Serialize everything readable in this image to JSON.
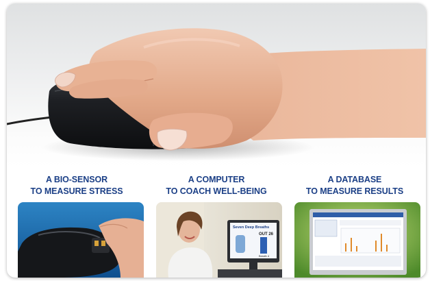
{
  "panels": [
    {
      "line1": "A BIO-SENSOR",
      "line2": "TO MEASURE STRESS"
    },
    {
      "line1": "A COMPUTER",
      "line2": "TO COACH WELL-BEING"
    },
    {
      "line1": "A DATABASE",
      "line2": "TO MEASURE RESULTS"
    }
  ],
  "screen": {
    "heading": "Seven Deep Breaths",
    "counter": "OUT 26",
    "footer": "Breath 4"
  },
  "colors": {
    "label_blue": "#1b3f86",
    "mouse_black": "#1a1c1f",
    "skin": "#e9b79a",
    "thumb_sky": "#2f86c6",
    "thumb_green": "#6aa238"
  }
}
